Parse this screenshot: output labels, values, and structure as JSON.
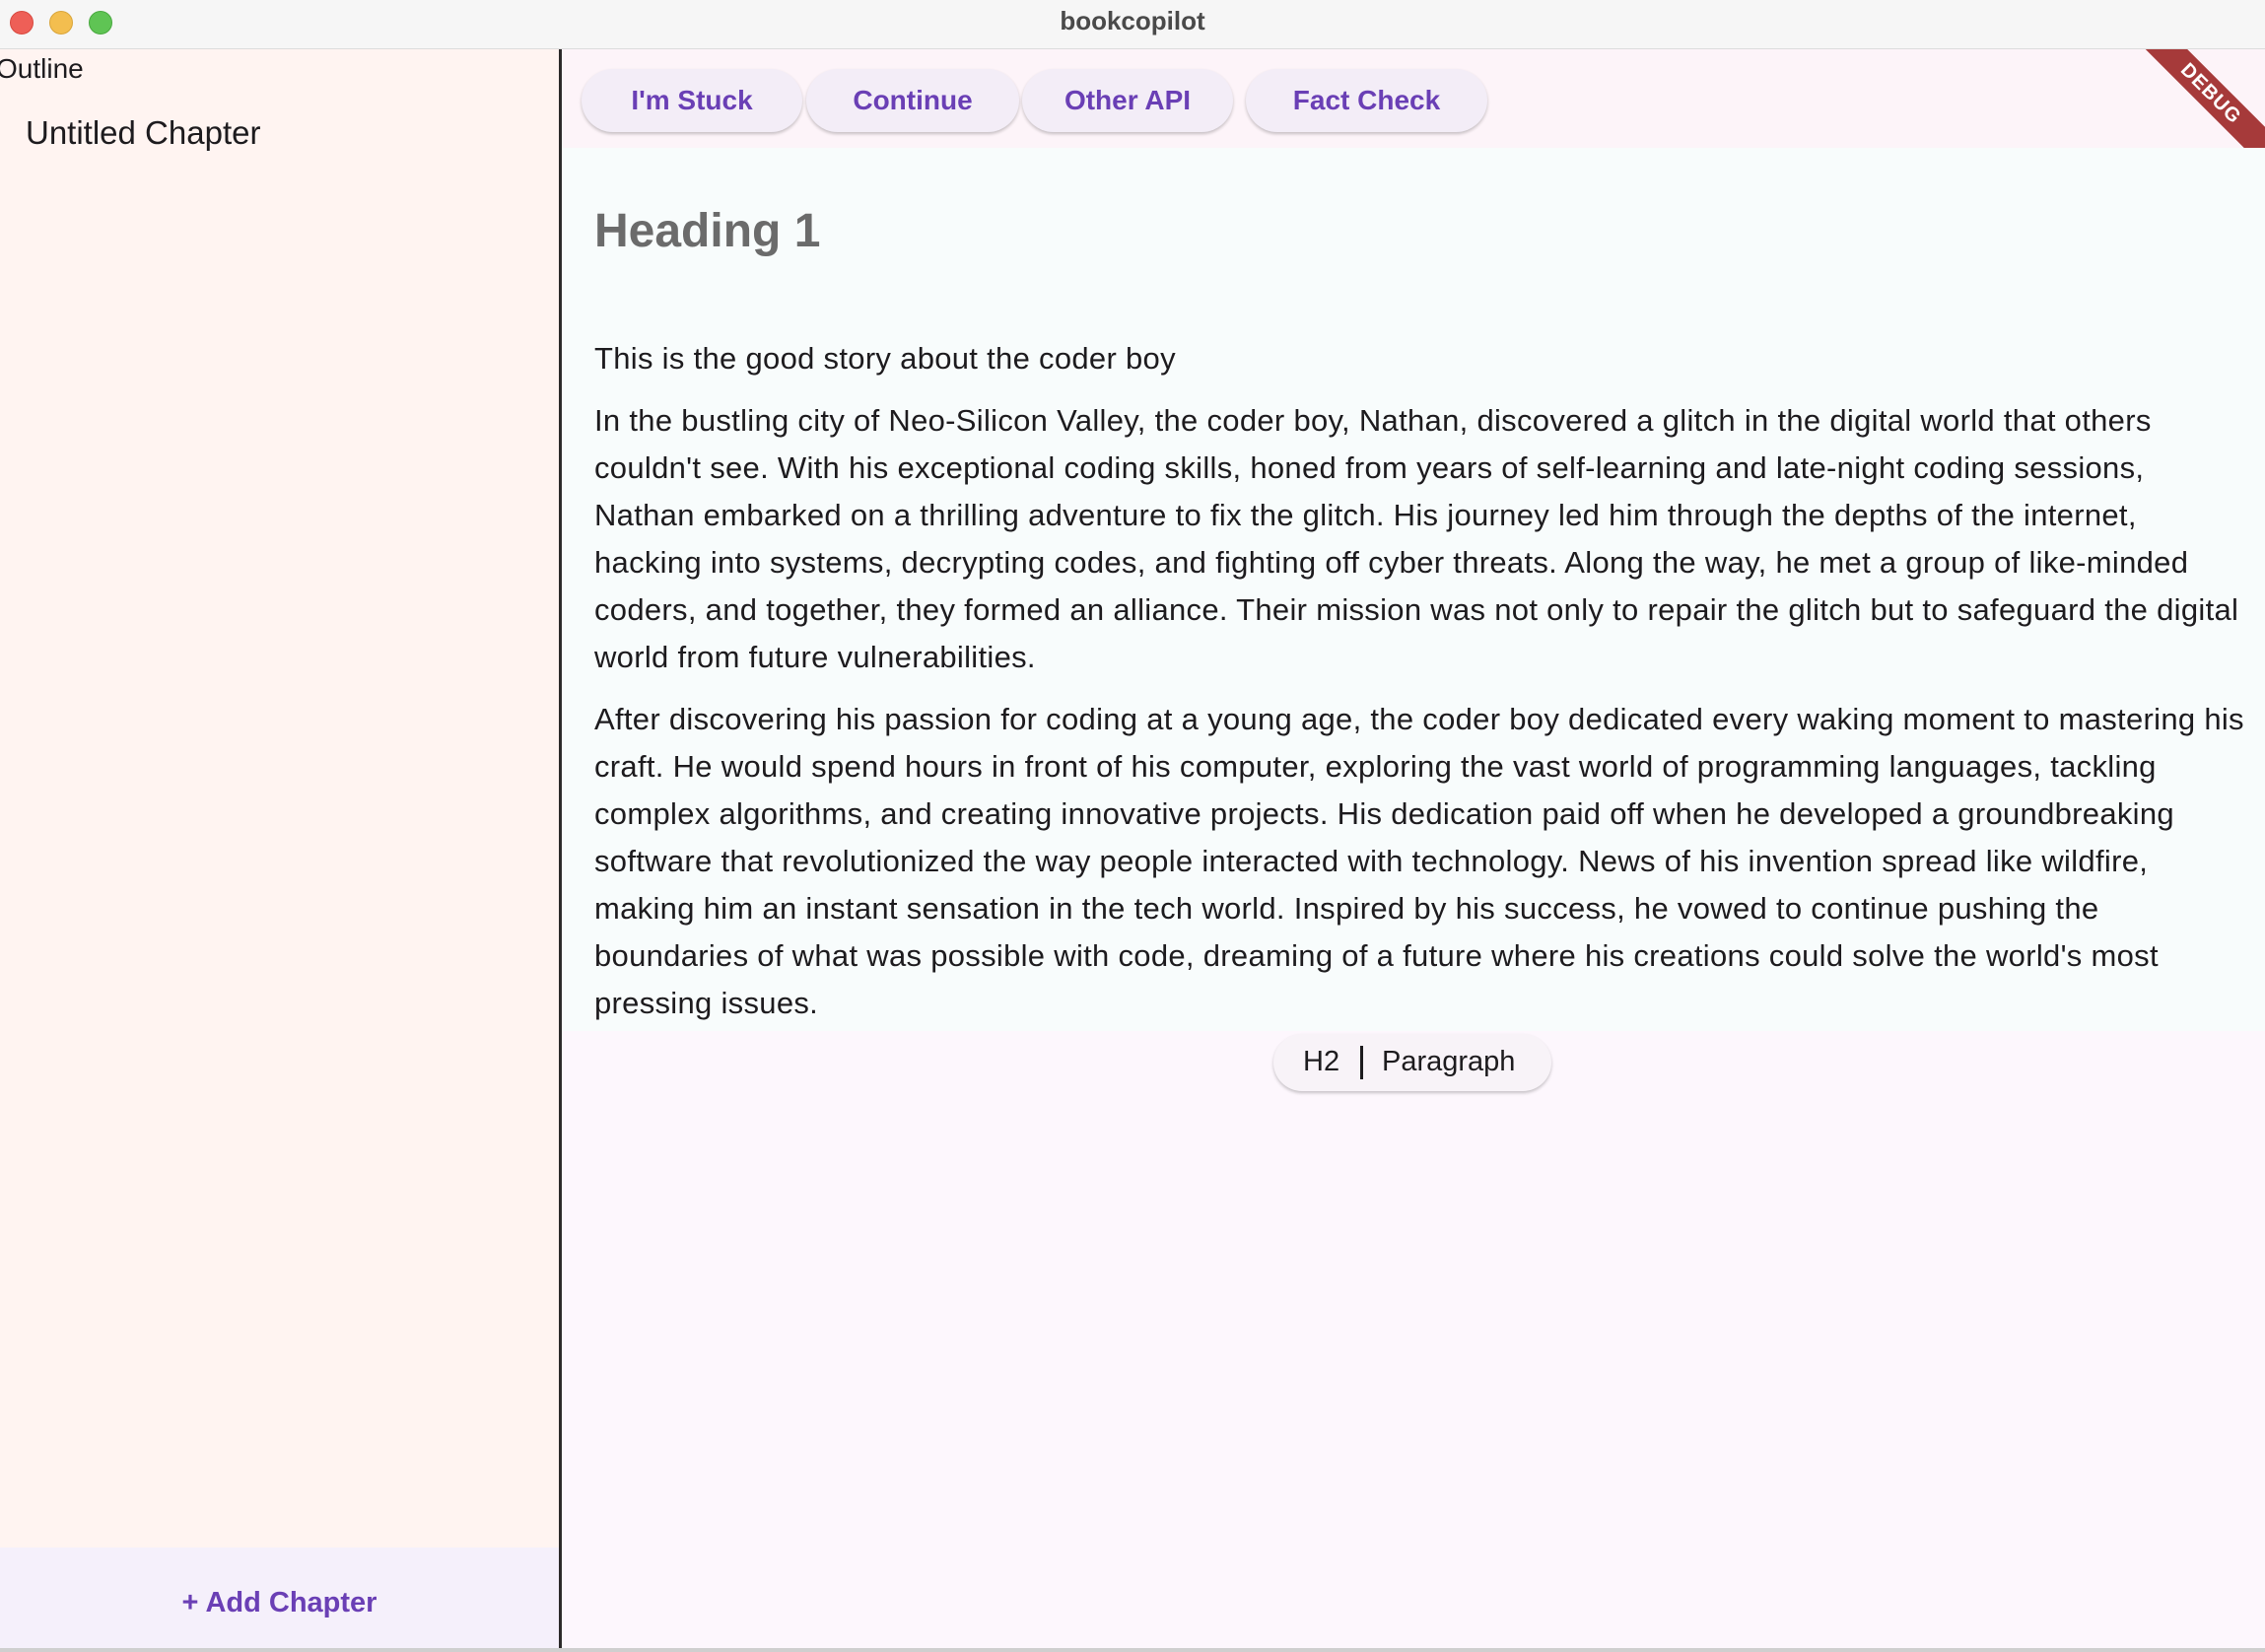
{
  "window": {
    "title": "bookcopilot"
  },
  "sidebar": {
    "title": "Outline",
    "chapters": [
      {
        "label": "Untitled Chapter"
      }
    ],
    "add_chapter_label": "+ Add Chapter"
  },
  "toolbar": {
    "buttons": [
      {
        "label": "I'm Stuck"
      },
      {
        "label": "Continue"
      },
      {
        "label": "Other API"
      },
      {
        "label": "Fact Check"
      }
    ]
  },
  "debug_banner": "DEBUG",
  "editor": {
    "heading": "Heading 1",
    "paragraphs": [
      "This is the good story about the coder boy",
      "In the bustling city of Neo-Silicon Valley, the coder boy, Nathan, discovered a glitch in the digital world that others couldn't see. With his exceptional coding skills, honed from years of self-learning and late-night coding sessions, Nathan embarked on a thrilling adventure to fix the glitch. His journey led him through the depths of the internet, hacking into systems, decrypting codes, and fighting off cyber threats. Along the way, he met a group of like-minded coders, and together, they formed an alliance. Their mission was not only to repair the glitch but to safeguard the digital world from future vulnerabilities.",
      "After discovering his passion for coding at a young age, the coder boy dedicated every waking moment to mastering his craft. He would spend hours in front of his computer, exploring the vast world of programming languages, tackling complex algorithms, and creating innovative projects. His dedication paid off when he developed a groundbreaking software that revolutionized the way people interacted with technology. News of his invention spread like wildfire, making him an instant sensation in the tech world. Inspired by his success, he vowed to continue pushing the boundaries of what was possible with code, dreaming of a future where his creations could solve the world's most pressing issues."
    ]
  },
  "format_bar": {
    "h2_label": "H2",
    "paragraph_label": "Paragraph"
  },
  "colors": {
    "accent": "#6a3fb5",
    "sidebar_bg": "#fff4f1",
    "editor_bg": "#f8fcfc",
    "debug": "#a63a3a"
  }
}
